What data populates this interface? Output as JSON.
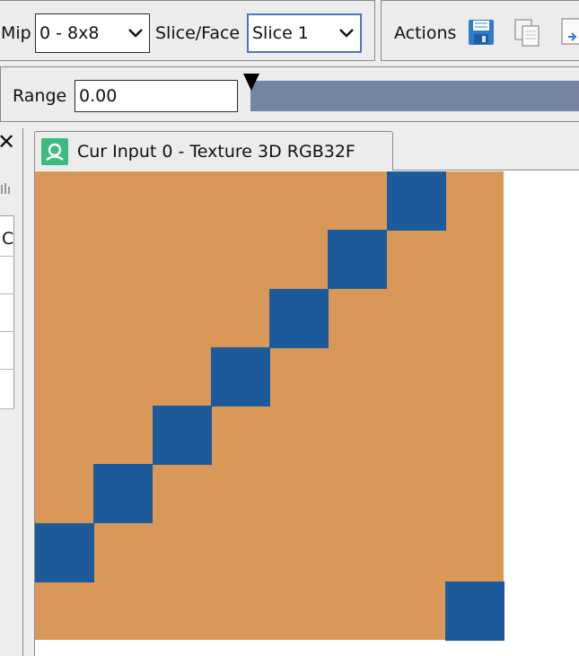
{
  "toolbar": {
    "mip_label": "Mip",
    "mip_value": "0 - 8x8",
    "slice_label": "Slice/Face",
    "slice_value": "Slice 1",
    "actions_label": "Actions",
    "icons": [
      "save-icon",
      "copy-icon",
      "export-icon"
    ]
  },
  "range": {
    "label": "Range",
    "value": "0.00"
  },
  "left_panel": {
    "close_glyph": "✕",
    "header_fragment": "C"
  },
  "tab": {
    "title": "Cur Input 0 - Texture 3D RGB32F"
  },
  "texture": {
    "width": 8,
    "height": 8,
    "background_color": "#d99857",
    "cell_color": "#1c5a9b",
    "blue_cells": [
      [
        6,
        0
      ],
      [
        5,
        1
      ],
      [
        4,
        2
      ],
      [
        3,
        3
      ],
      [
        2,
        4
      ],
      [
        1,
        5
      ],
      [
        0,
        6
      ],
      [
        7,
        7
      ]
    ]
  },
  "colors": {
    "range_bar": "#7585a1",
    "tab_icon_bg": "#3dba80"
  }
}
